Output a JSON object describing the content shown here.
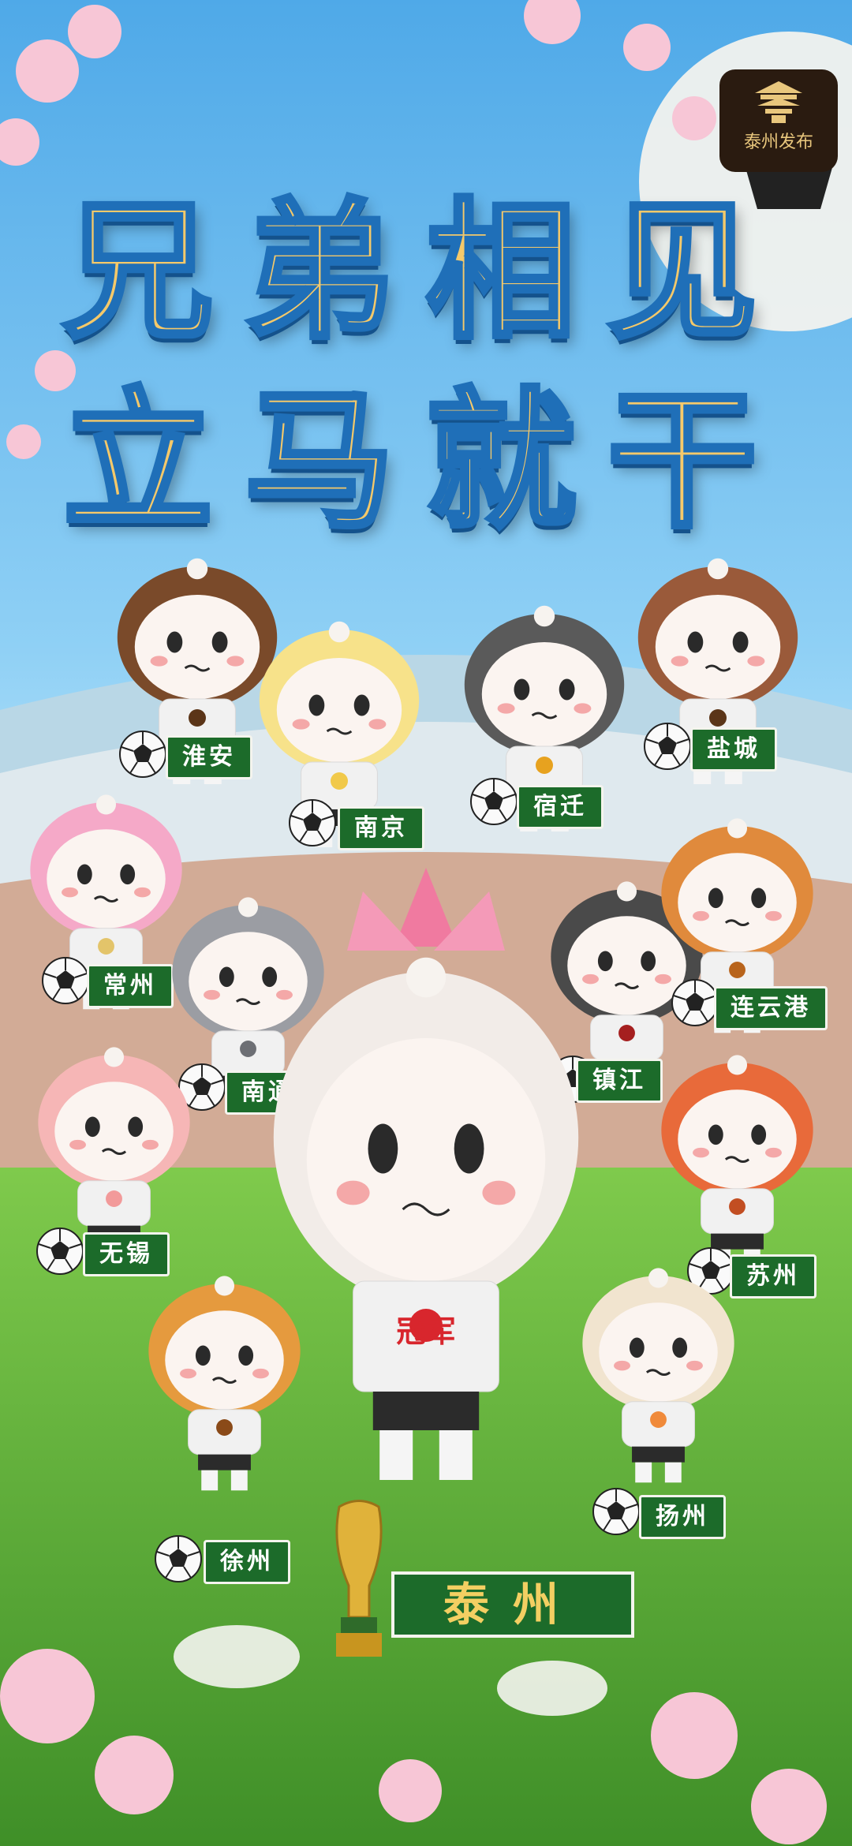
{
  "logo": {
    "text": "泰州发布",
    "icon": "pavilion-icon"
  },
  "title": {
    "line1": "兄弟相见",
    "line2": "立马就干"
  },
  "cities": [
    {
      "name": "淮安",
      "hair": "#7a4a2a",
      "accent": "#5b3518"
    },
    {
      "name": "南京",
      "hair": "#f7e28a",
      "accent": "#f1c94a"
    },
    {
      "name": "宿迁",
      "hair": "#5a5a5a",
      "accent": "#e7a21f"
    },
    {
      "name": "盐城",
      "hair": "#9a5a3a",
      "accent": "#5b3518"
    },
    {
      "name": "常州",
      "hair": "#f5a9c8",
      "accent": "#e3c46a"
    },
    {
      "name": "南通",
      "hair": "#9b9da3",
      "accent": "#6d6f74"
    },
    {
      "name": "镇江",
      "hair": "#4a4a4a",
      "accent": "#a51f1f"
    },
    {
      "name": "连云港",
      "hair": "#e08a3c",
      "accent": "#b8641c"
    },
    {
      "name": "无锡",
      "hair": "#f6b6b6",
      "accent": "#f29a9a"
    },
    {
      "name": "苏州",
      "hair": "#e86a3a",
      "accent": "#c24e22"
    },
    {
      "name": "徐州",
      "hair": "#e59a3e",
      "accent": "#8a4a18"
    },
    {
      "name": "扬州",
      "hair": "#f1e4cf",
      "accent": "#f08a3a"
    }
  ],
  "champion": {
    "name": "泰州",
    "jersey_text": "冠军",
    "trophy_icon": "trophy-icon"
  },
  "colors": {
    "sky": "#7fc3ef",
    "grass": "#5fae3a",
    "label_green": "#1c6b2a",
    "title_gold": "#f5c96a",
    "title_outline": "#1f6fb8"
  }
}
